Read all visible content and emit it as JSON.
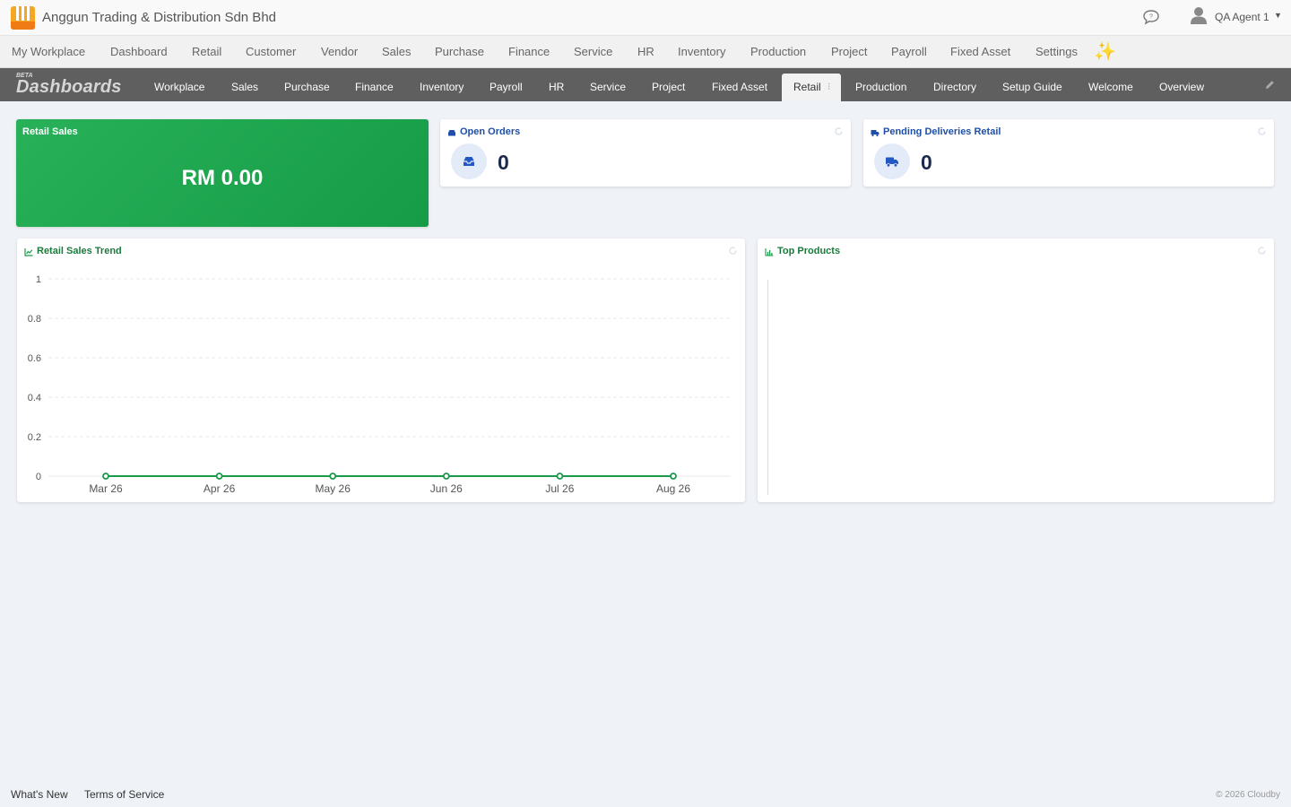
{
  "header": {
    "company": "Anggun Trading & Distribution Sdn Bhd",
    "user_name": "QA Agent 1"
  },
  "main_nav": [
    "My Workplace",
    "Dashboard",
    "Retail",
    "Customer",
    "Vendor",
    "Sales",
    "Purchase",
    "Finance",
    "Service",
    "HR",
    "Inventory",
    "Production",
    "Project",
    "Payroll",
    "Fixed Asset",
    "Settings"
  ],
  "dashboards": {
    "beta": "BETA",
    "title": "Dashboards",
    "tabs": [
      "Workplace",
      "Sales",
      "Purchase",
      "Finance",
      "Inventory",
      "Payroll",
      "HR",
      "Service",
      "Project",
      "Fixed Asset",
      "Retail",
      "Production",
      "Directory",
      "Setup Guide",
      "Welcome",
      "Overview"
    ],
    "active_tab": "Retail"
  },
  "widgets": {
    "retail_sales": {
      "title": "Retail Sales",
      "value": "RM 0.00"
    },
    "open_orders": {
      "title": "Open Orders",
      "value": "0"
    },
    "pending_deliveries": {
      "title": "Pending Deliveries Retail",
      "value": "0"
    },
    "trend": {
      "title": "Retail Sales Trend"
    },
    "top_products": {
      "title": "Top Products"
    }
  },
  "chart_data": {
    "type": "line",
    "title": "Retail Sales Trend",
    "categories": [
      "Mar 26",
      "Apr 26",
      "May 26",
      "Jun 26",
      "Jul 26",
      "Aug 26"
    ],
    "values": [
      0,
      0,
      0,
      0,
      0,
      0
    ],
    "ylim": [
      0,
      1
    ],
    "y_ticks": [
      "1",
      "0.8",
      "0.6",
      "0.4",
      "0.2",
      "0"
    ],
    "grid": true,
    "color": "#1a9a4a"
  },
  "footer": {
    "whats_new": "What's New",
    "terms": "Terms of Service",
    "copyright": "© 2026 Cloudby"
  },
  "colors": {
    "accent_green": "#1a9a4a",
    "accent_blue": "#1f4fa8",
    "dashbar": "#5f5f5f"
  }
}
